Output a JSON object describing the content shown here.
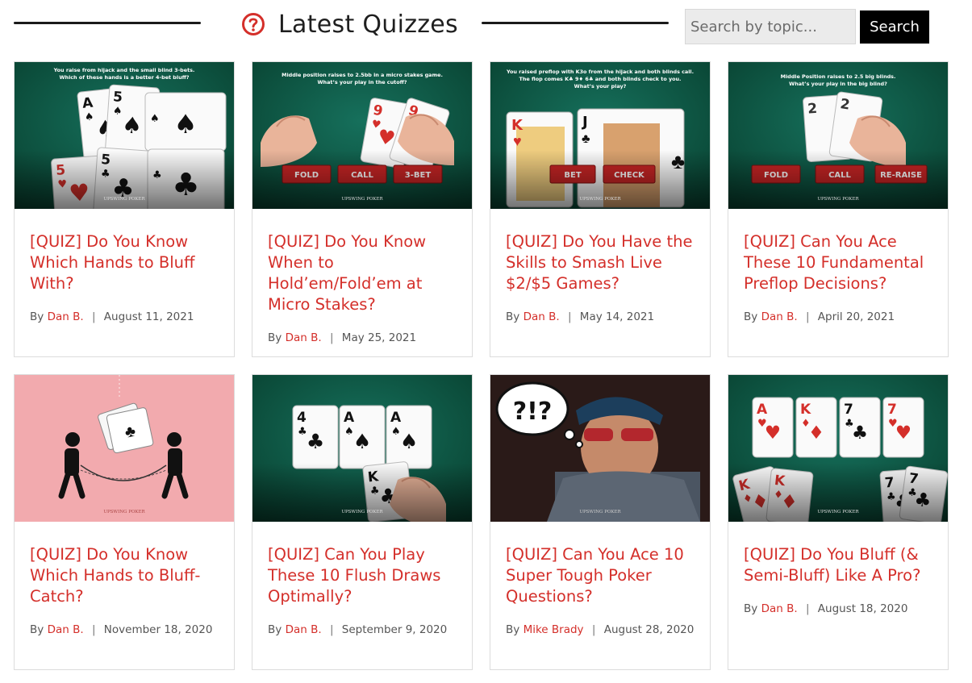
{
  "header": {
    "title": "Latest Quizzes",
    "icon": "question-circle-icon",
    "accent_color": "#d42f2a"
  },
  "search": {
    "placeholder": "Search by topic...",
    "value": "",
    "button_label": "Search"
  },
  "byline_prefix": "By",
  "separator": "|",
  "cards": [
    {
      "title": "[QUIZ] Do You Know Which Hands to Bluff With?",
      "author": "Dan B.",
      "date": "August 11, 2021",
      "image": {
        "caption_lines": [
          "You raise from hijack and the small blind 3-bets.",
          "Which of these hands is a better 4-bet bluff?"
        ],
        "cards": [
          "A♠",
          "5♠",
          "5♥",
          "5♣"
        ],
        "logo": "UPSWING POKER"
      }
    },
    {
      "title": "[QUIZ] Do You Know When to Hold’em/Fold’em at Micro Stakes?",
      "author": "Dan B.",
      "date": "May 25, 2021",
      "image": {
        "caption_lines": [
          "Middle position raises to 2.5bb in a micro stakes game.",
          "What’s your play in the cutoff?"
        ],
        "cards": [
          "9♥",
          "9♥"
        ],
        "buttons": [
          "FOLD",
          "CALL",
          "3-BET"
        ],
        "logo": "UPSWING POKER"
      }
    },
    {
      "title": "[QUIZ] Do You Have the Skills to Smash Live $2/$5 Games?",
      "author": "Dan B.",
      "date": "May 14, 2021",
      "image": {
        "caption_lines": [
          "You raised preflop with K3o from the hijack and both blinds call.",
          "The flop comes K♣ 9♦ 6♣ and both blinds check to you.",
          "What’s your play?"
        ],
        "cards": [
          "K♥",
          "J♣"
        ],
        "buttons": [
          "BET",
          "CHECK"
        ],
        "logo": "UPSWING POKER"
      }
    },
    {
      "title": "[QUIZ] Can You Ace These 10 Fundamental Preflop Decisions?",
      "author": "Dan B.",
      "date": "April 20, 2021",
      "image": {
        "caption_lines": [
          "Middle Position raises to 2.5 big blinds.",
          "What’s your play in the big blind?"
        ],
        "cards": [
          "2",
          "2"
        ],
        "buttons": [
          "FOLD",
          "CALL",
          "RE-RAISE"
        ],
        "logo": "UPSWING POKER"
      }
    },
    {
      "title": "[QUIZ] Do You Know Which Hands to Bluff-Catch?",
      "author": "Dan B.",
      "date": "November 18, 2020",
      "image": {
        "caption_lines": [],
        "cards": [
          "♣"
        ],
        "logo": "UPSWING POKER"
      }
    },
    {
      "title": "[QUIZ] Can You Play These 10 Flush Draws Optimally?",
      "author": "Dan B.",
      "date": "September 9, 2020",
      "image": {
        "caption_lines": [],
        "cards": [
          "4♣",
          "A♠",
          "A♠",
          "K♣"
        ],
        "logo": "UPSWING POKER"
      }
    },
    {
      "title": "[QUIZ] Can You Ace 10 Super Tough Poker Questions?",
      "author": "Mike Brady",
      "date": "August 28, 2020",
      "image": {
        "caption_lines": [],
        "thought_bubble": "?!?",
        "logo": "UPSWING POKER"
      }
    },
    {
      "title": "[QUIZ] Do You Bluff (& Semi-Bluff) Like A Pro?",
      "author": "Dan B.",
      "date": "August 18, 2020",
      "image": {
        "caption_lines": [],
        "cards": [
          "A♥",
          "K♦",
          "7♣",
          "7♥",
          "K♦",
          "7♣"
        ],
        "logo": "UPSWING POKER"
      }
    }
  ]
}
